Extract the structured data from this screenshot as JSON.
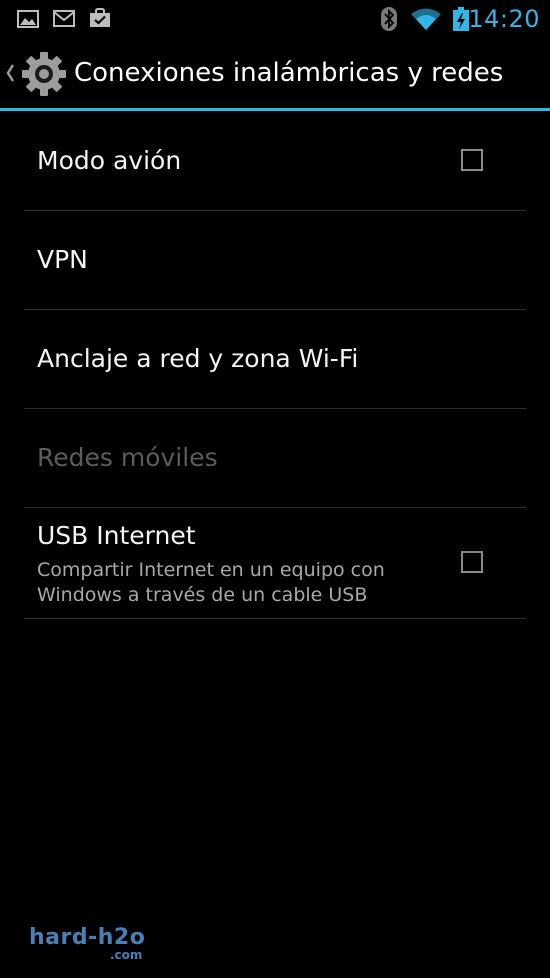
{
  "status_bar": {
    "time": "14:20",
    "icons": [
      "image-notification-icon",
      "gmail-notification-icon",
      "market-notification-icon",
      "bluetooth-icon",
      "wifi-icon",
      "battery-charging-icon"
    ],
    "accent_color": "#33b5e5"
  },
  "action_bar": {
    "title": "Conexiones inalámbricas y redes",
    "app_icon": "settings-gear-icon"
  },
  "items": [
    {
      "title": "Modo avión",
      "checkbox": true,
      "checked": false,
      "enabled": true
    },
    {
      "title": "VPN",
      "enabled": true
    },
    {
      "title": "Anclaje a red y zona Wi-Fi",
      "enabled": true
    },
    {
      "title": "Redes móviles",
      "enabled": false
    },
    {
      "title": "USB Internet",
      "summary": "Compartir Internet en un equipo con Windows a través de un cable USB",
      "checkbox": true,
      "checked": false,
      "enabled": true
    }
  ],
  "watermark": {
    "text": "hard-h2o",
    "sub": ".com"
  }
}
